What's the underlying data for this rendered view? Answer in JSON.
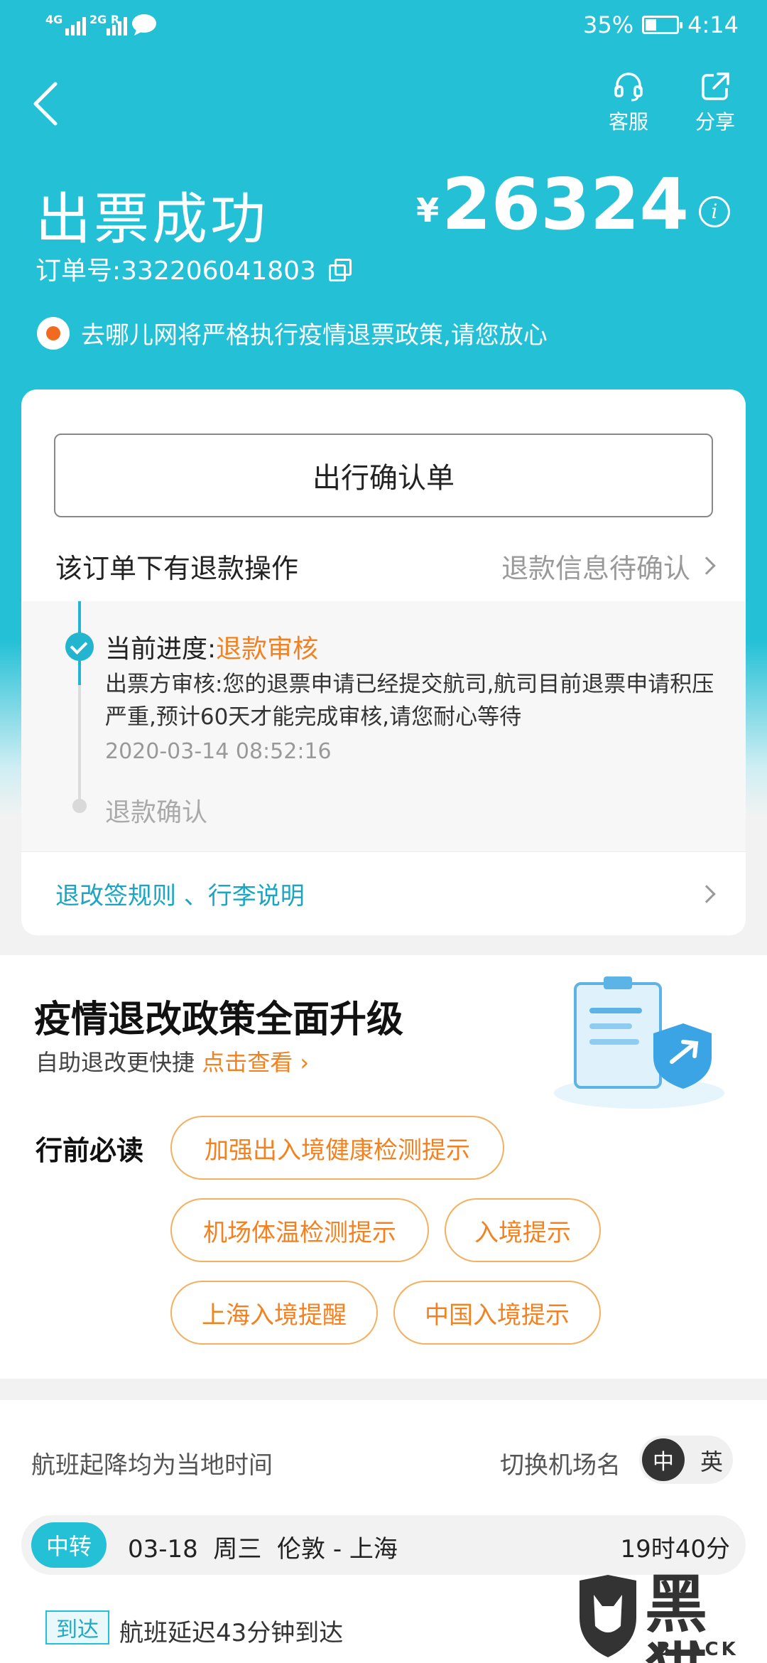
{
  "status_bar": {
    "network_1": "4G",
    "network_2": "2G R",
    "battery_percent": "35%",
    "battery_level": 0.35,
    "time": "4:14"
  },
  "header": {
    "service_label": "客服",
    "share_label": "分享",
    "title": "出票成功",
    "currency": "¥",
    "price": "26324",
    "info_icon": "i",
    "order_number": "订单号:332206041803",
    "notice": "去哪儿网将严格执行疫情退票政策,请您放心"
  },
  "order_card": {
    "confirm_button": "出行确认单",
    "refund_label": "该订单下有退款操作",
    "refund_status": "退款信息待确认",
    "progress": {
      "current_prefix": "当前进度:",
      "current_status": "退款审核",
      "description": "出票方审核:您的退票申请已经提交航司,航司目前退票申请积压严重,预计60天才能完成审核,请您耐心等待",
      "time": "2020-03-14 08:52:16",
      "next_step": "退款确认"
    },
    "rules_link": "退改签规则 、行李说明"
  },
  "policy_card": {
    "title": "疫情退改政策全面升级",
    "subtitle": "自助退改更快捷",
    "link": "点击查看",
    "must_read": "行前必读",
    "tags": [
      "加强出入境健康检测提示",
      "机场体温检测提示",
      "入境提示",
      "上海入境提醒",
      "中国入境提示"
    ]
  },
  "flight_card": {
    "local_time_note": "航班起降均为当地时间",
    "switch_label": "切换机场名",
    "lang_zh": "中",
    "lang_en": "英",
    "transfer_badge": "中转",
    "flight_info": "03-18  周三  伦敦 - 上海",
    "duration": "19时40分",
    "arrive_badge": "到达",
    "arrive_text": "航班延迟43分钟到达"
  },
  "watermark": {
    "big": "黑猫",
    "small": "BLACK CAT"
  },
  "colors": {
    "accent": "#23c0d6",
    "orange": "#f4811f",
    "link_blue": "#1aa6c2"
  }
}
